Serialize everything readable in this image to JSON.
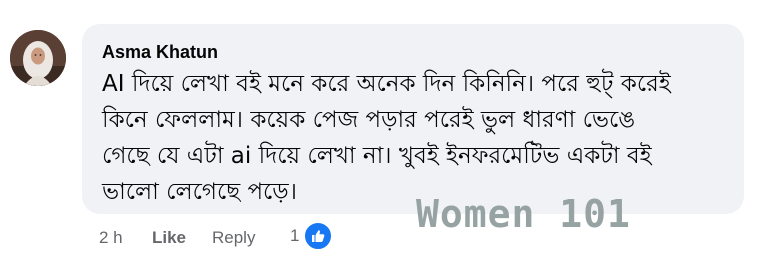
{
  "comment": {
    "author": "Asma Khatun",
    "text_lines": [
      "AI দিয়ে লেখা বই মনে করে অনেক দিন কিনিনি। পরে হুট্ করেই",
      "কিনে ফেললাম। কয়েক পেজ পড়ার পরেই ভুল ধারণা ভেঙে",
      "গেছে যে এটা ai দিয়ে লেখা না। খুবই ইনফরমেটিভ একটা বই",
      "ভালো লেগেছে পড়ে।"
    ],
    "watermark": "Women 101"
  },
  "actions": {
    "time": "2 h",
    "like_label": "Like",
    "reply_label": "Reply"
  },
  "reactions": {
    "count": "1",
    "icon": "like-icon",
    "color": "#1877f2"
  },
  "colors": {
    "bubble": "#f0f2f5",
    "meta_text": "#65676b",
    "watermark": "#97a3a3"
  }
}
